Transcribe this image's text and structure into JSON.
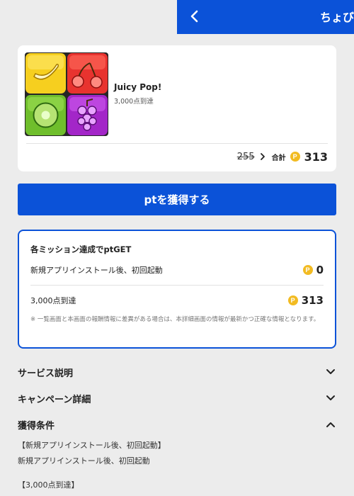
{
  "header": {
    "title": "ちょびリッチ"
  },
  "app": {
    "name": "Juicy Pop!",
    "condition": "3,000点到達"
  },
  "points": {
    "old": "255",
    "total_label": "合計",
    "coin_symbol": "P",
    "total": "313"
  },
  "cta": {
    "label": "ptを獲得する"
  },
  "missions": {
    "title": "各ミッション達成でptGET",
    "items": [
      {
        "label": "新規アプリインストール後、初回起動",
        "points": "0"
      },
      {
        "label": "3,000点到達",
        "points": "313"
      }
    ],
    "note": "※ 一覧画面と本画面の報酬情報に差異がある場合は、本詳細画面の情報が最新かつ正確な情報となります。"
  },
  "accordions": [
    {
      "label": "サービス説明",
      "state": "collapsed"
    },
    {
      "label": "キャンペーン詳細",
      "state": "collapsed"
    },
    {
      "label": "獲得条件",
      "state": "expanded"
    }
  ],
  "conditions": [
    "【新規アプリインストール後、初回起動】",
    "新規アプリインストール後、初回起動",
    "【3,000点到達】"
  ],
  "colors": {
    "brand": "#0b52d8",
    "coin": "#f2bb22",
    "background": "#ececec"
  },
  "icons": {
    "back": "chevron-left-icon",
    "expand": "chevron-down-icon",
    "collapse": "chevron-up-icon",
    "coin": "point-coin-icon"
  }
}
